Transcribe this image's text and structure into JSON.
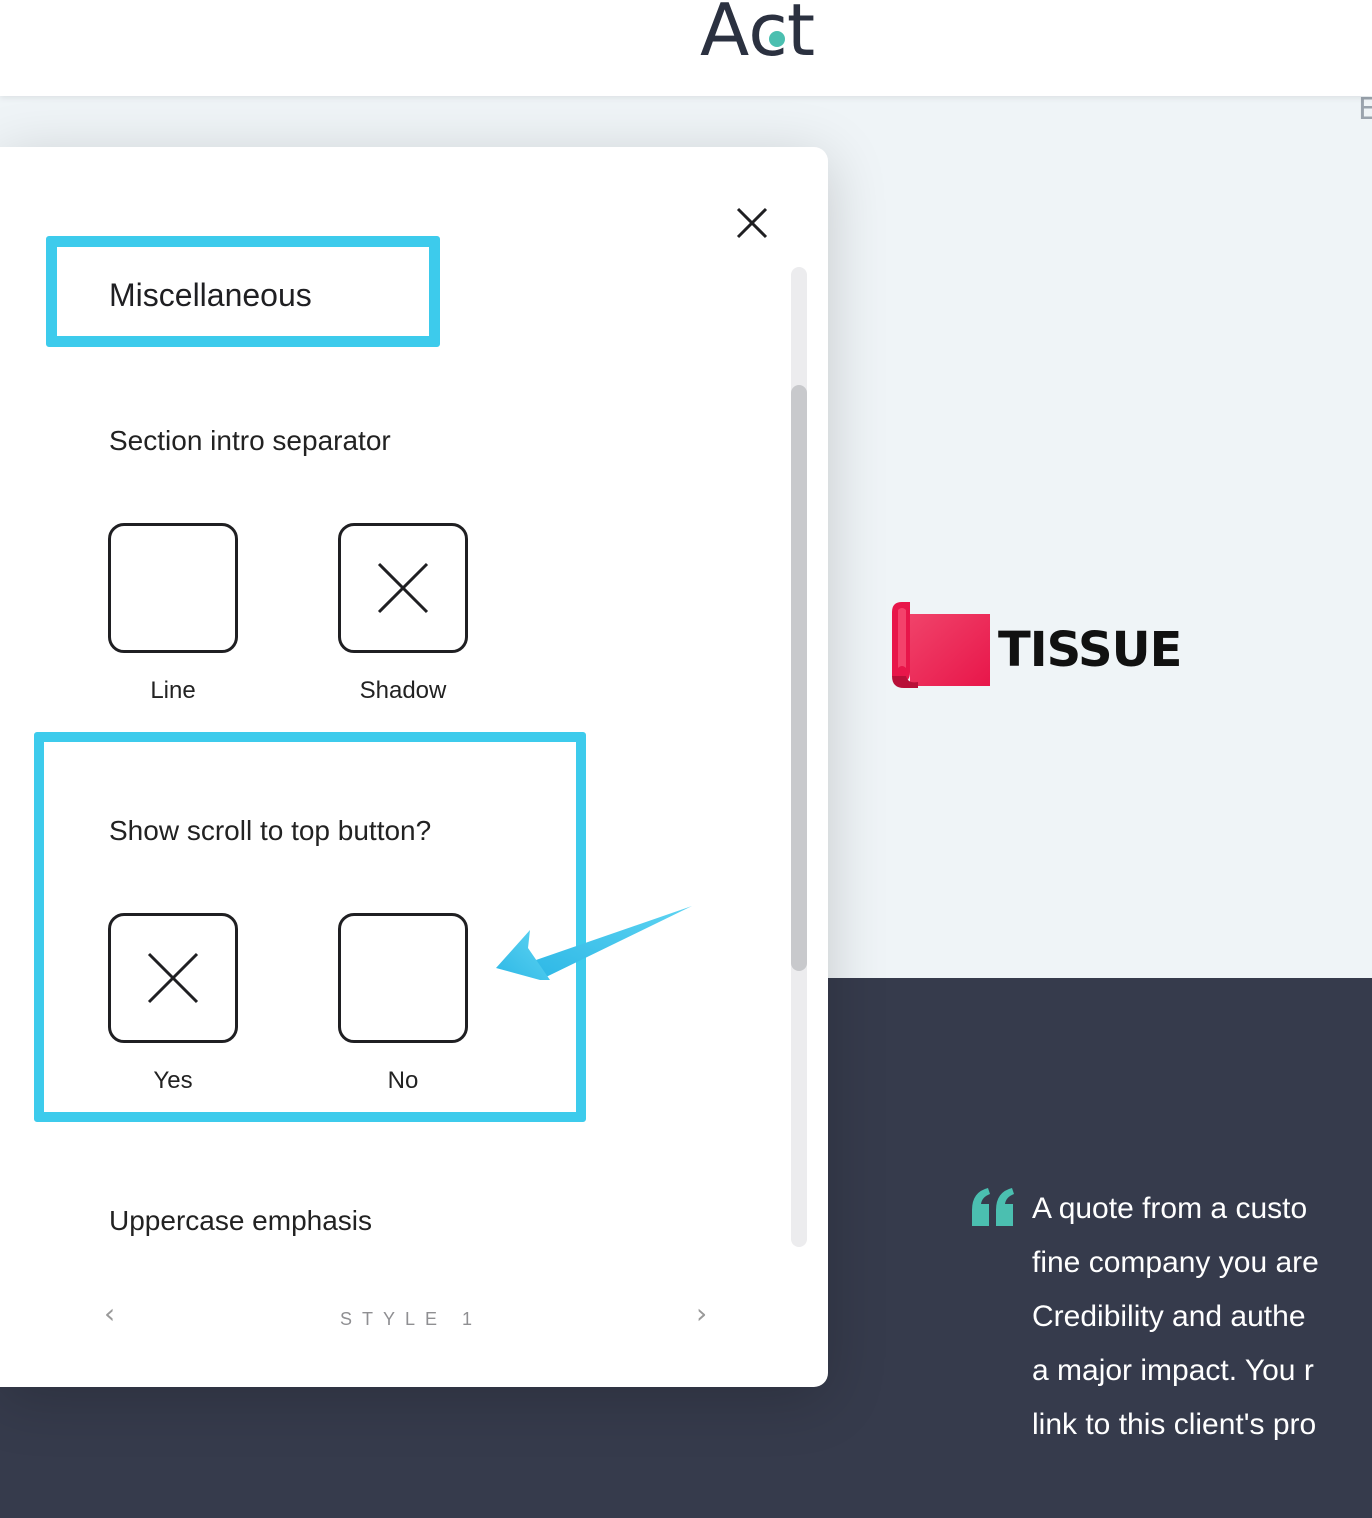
{
  "header": {
    "logo_text": "Act",
    "logo_accent_color": "#4bbfb0",
    "right_edge_glyph": "E"
  },
  "brand": {
    "tissue_text": "TISSUE",
    "tissue_color": "#ee2a58"
  },
  "panel": {
    "section_title": "Miscellaneous",
    "close_icon": "close-icon",
    "groups": [
      {
        "heading": "Section intro separator",
        "options": [
          {
            "label": "Line",
            "selected": false
          },
          {
            "label": "Shadow",
            "selected": true
          }
        ]
      },
      {
        "heading": "Show scroll to top button?",
        "options": [
          {
            "label": "Yes",
            "selected": true
          },
          {
            "label": "No",
            "selected": false
          }
        ]
      }
    ],
    "next_heading": "Uppercase emphasis",
    "style_nav": {
      "label": "STYLE 1",
      "prev_icon": "chevron-left-icon",
      "next_icon": "chevron-right-icon"
    }
  },
  "quote": {
    "lines": [
      "A quote from a custo",
      "fine company you are",
      "Credibility and authe",
      "a major impact. You r",
      "link to this client's pro"
    ],
    "mark_color": "#4bbfb0"
  },
  "highlight_color": "#3dcbec"
}
